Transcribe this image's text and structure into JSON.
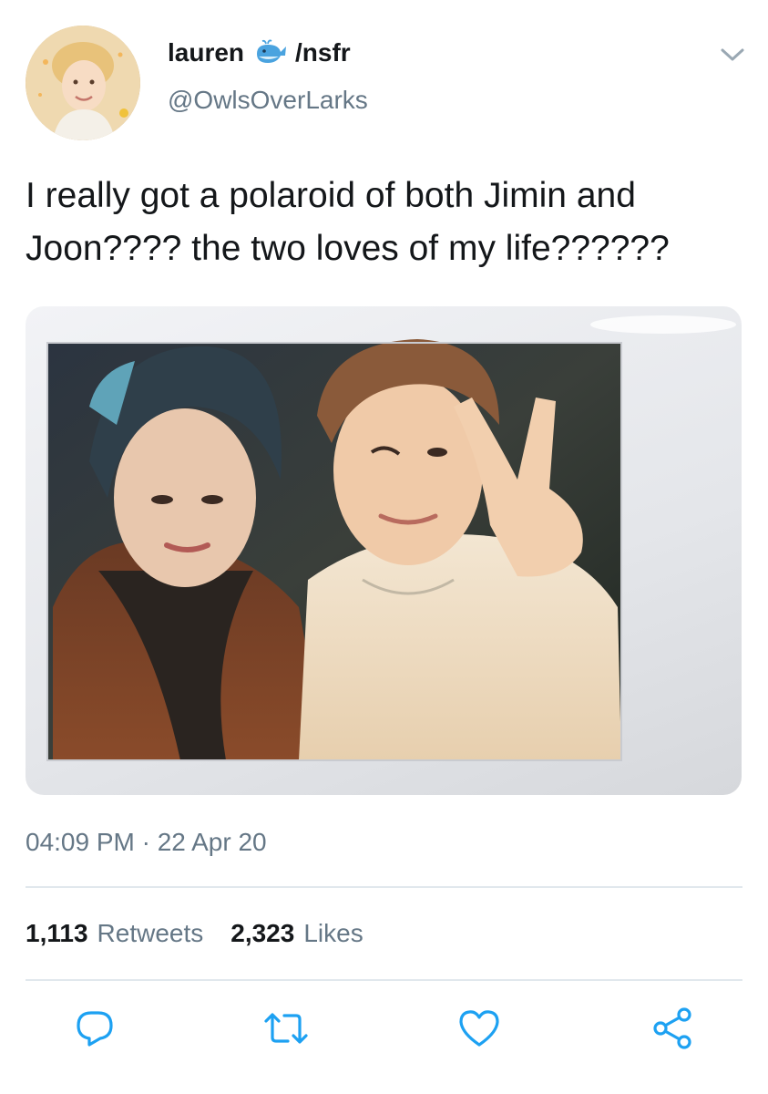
{
  "author": {
    "display_name": "lauren",
    "name_suffix": "/nsfr",
    "handle": "@OwlsOverLarks",
    "avatar_icon": "profile-avatar",
    "badge_icon": "whale-emoji-icon"
  },
  "tweet": {
    "text": "I really got a polaroid of both Jimin and\nJoon???? the two loves of my life??????",
    "media_icon": "polaroid-photo",
    "timestamp": "04:09 PM · 22 Apr 20"
  },
  "stats": {
    "retweets_count": "1,113",
    "retweets_label": "Retweets",
    "likes_count": "2,323",
    "likes_label": "Likes"
  },
  "actions": [
    {
      "name": "reply",
      "icon": "reply-icon"
    },
    {
      "name": "retweet",
      "icon": "retweet-icon"
    },
    {
      "name": "like",
      "icon": "heart-icon"
    },
    {
      "name": "share",
      "icon": "share-icon"
    }
  ],
  "colors": {
    "text_primary": "#14171a",
    "text_secondary": "#657786",
    "divider": "#e1e8ed",
    "icon_accent": "#1da1f2"
  }
}
